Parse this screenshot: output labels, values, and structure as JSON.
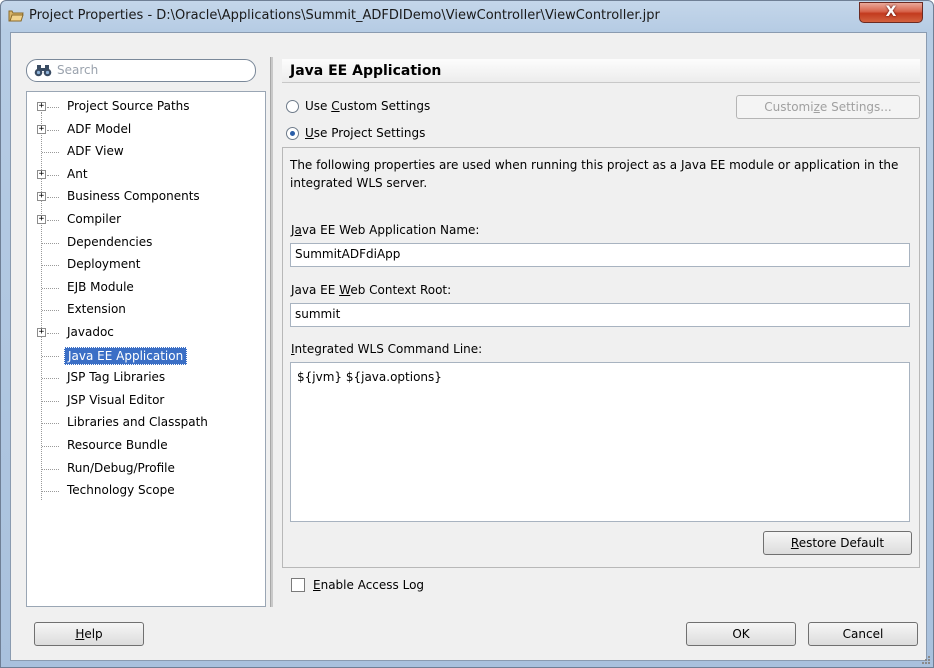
{
  "window": {
    "title": "Project Properties - D:\\Oracle\\Applications\\Summit_ADFDIDemo\\ViewController\\ViewController.jpr",
    "close_label": "X"
  },
  "search": {
    "placeholder": "Search",
    "value": ""
  },
  "tree": {
    "items": [
      {
        "label": "Project Source Paths",
        "expandable": true
      },
      {
        "label": "ADF Model",
        "expandable": true
      },
      {
        "label": "ADF View",
        "expandable": false
      },
      {
        "label": "Ant",
        "expandable": true
      },
      {
        "label": "Business Components",
        "expandable": true
      },
      {
        "label": "Compiler",
        "expandable": true
      },
      {
        "label": "Dependencies",
        "expandable": false
      },
      {
        "label": "Deployment",
        "expandable": false
      },
      {
        "label": "EJB Module",
        "expandable": false
      },
      {
        "label": "Extension",
        "expandable": false
      },
      {
        "label": "Javadoc",
        "expandable": true
      },
      {
        "label": "Java EE Application",
        "expandable": false,
        "selected": true
      },
      {
        "label": "JSP Tag Libraries",
        "expandable": false
      },
      {
        "label": "JSP Visual Editor",
        "expandable": false
      },
      {
        "label": "Libraries and Classpath",
        "expandable": false
      },
      {
        "label": "Resource Bundle",
        "expandable": false
      },
      {
        "label": "Run/Debug/Profile",
        "expandable": false
      },
      {
        "label": "Technology Scope",
        "expandable": false
      }
    ]
  },
  "main": {
    "section_title": "Java EE Application",
    "radio_custom": {
      "pre": "Use ",
      "key": "C",
      "post": "ustom Settings",
      "selected": false
    },
    "radio_project": {
      "pre": "",
      "key": "U",
      "post": "se Project Settings",
      "selected": true
    },
    "customize_button": {
      "pre": "Customi",
      "key": "z",
      "post": "e Settings..."
    },
    "description": "The following properties are used when running this project as a Java EE module or application in the integrated WLS server.",
    "web_app_name": {
      "label_pre": "J",
      "label_key": "a",
      "label_post": "va EE Web Application Name:",
      "value": "SummitADFdiApp"
    },
    "context_root": {
      "label_pre": "Java EE ",
      "label_key": "W",
      "label_post": "eb Context Root:",
      "value": "summit"
    },
    "command_line": {
      "label_pre": "",
      "label_key": "I",
      "label_post": "ntegrated WLS Command Line:",
      "value": "${jvm} ${java.options}"
    },
    "restore_button": {
      "pre": "",
      "key": "R",
      "post": "estore Default"
    },
    "access_log": {
      "pre": "",
      "key": "E",
      "post": "nable Access Log",
      "checked": false
    }
  },
  "footer": {
    "help": {
      "pre": "",
      "key": "H",
      "post": "elp"
    },
    "ok": "OK",
    "cancel": "Cancel"
  }
}
